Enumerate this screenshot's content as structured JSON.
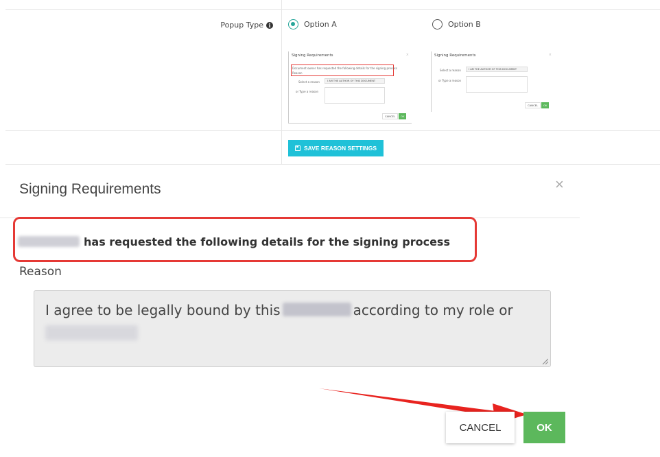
{
  "settings": {
    "popup_type_label": "Popup Type",
    "option_a_label": "Option A",
    "option_b_label": "Option B",
    "selected_option": "Option A",
    "save_button_label": "SAVE REASON SETTINGS",
    "accent_color": "#1fc1d8",
    "radio_color": "#26a69a"
  },
  "preview_a": {
    "title": "Signing Requirements",
    "message": "Document owner has requested the following details for the signing process",
    "reason_label": "Reason",
    "select_label": "Select a reason",
    "select_value": "I AM THE AUTHOR OF THIS DOCUMENT",
    "type_label": "or Type a reason",
    "cancel": "CANCEL",
    "ok": "OK"
  },
  "preview_b": {
    "title": "Signing Requirements",
    "select_label": "Select a reason",
    "select_value": "I AM THE AUTHOR OF THIS DOCUMENT",
    "type_label": "or Type a reason",
    "cancel": "CANCEL",
    "ok": "OK"
  },
  "dialog": {
    "title": "Signing Requirements",
    "close_glyph": "×",
    "message": "has requested the following details for the signing process",
    "reason_label": "Reason",
    "reason_text_1": "I agree to be legally bound by this",
    "reason_text_2": "according to my role or",
    "cancel_label": "CANCEL",
    "ok_label": "OK",
    "ok_color": "#5cb85c",
    "highlight_color": "#e53935"
  }
}
